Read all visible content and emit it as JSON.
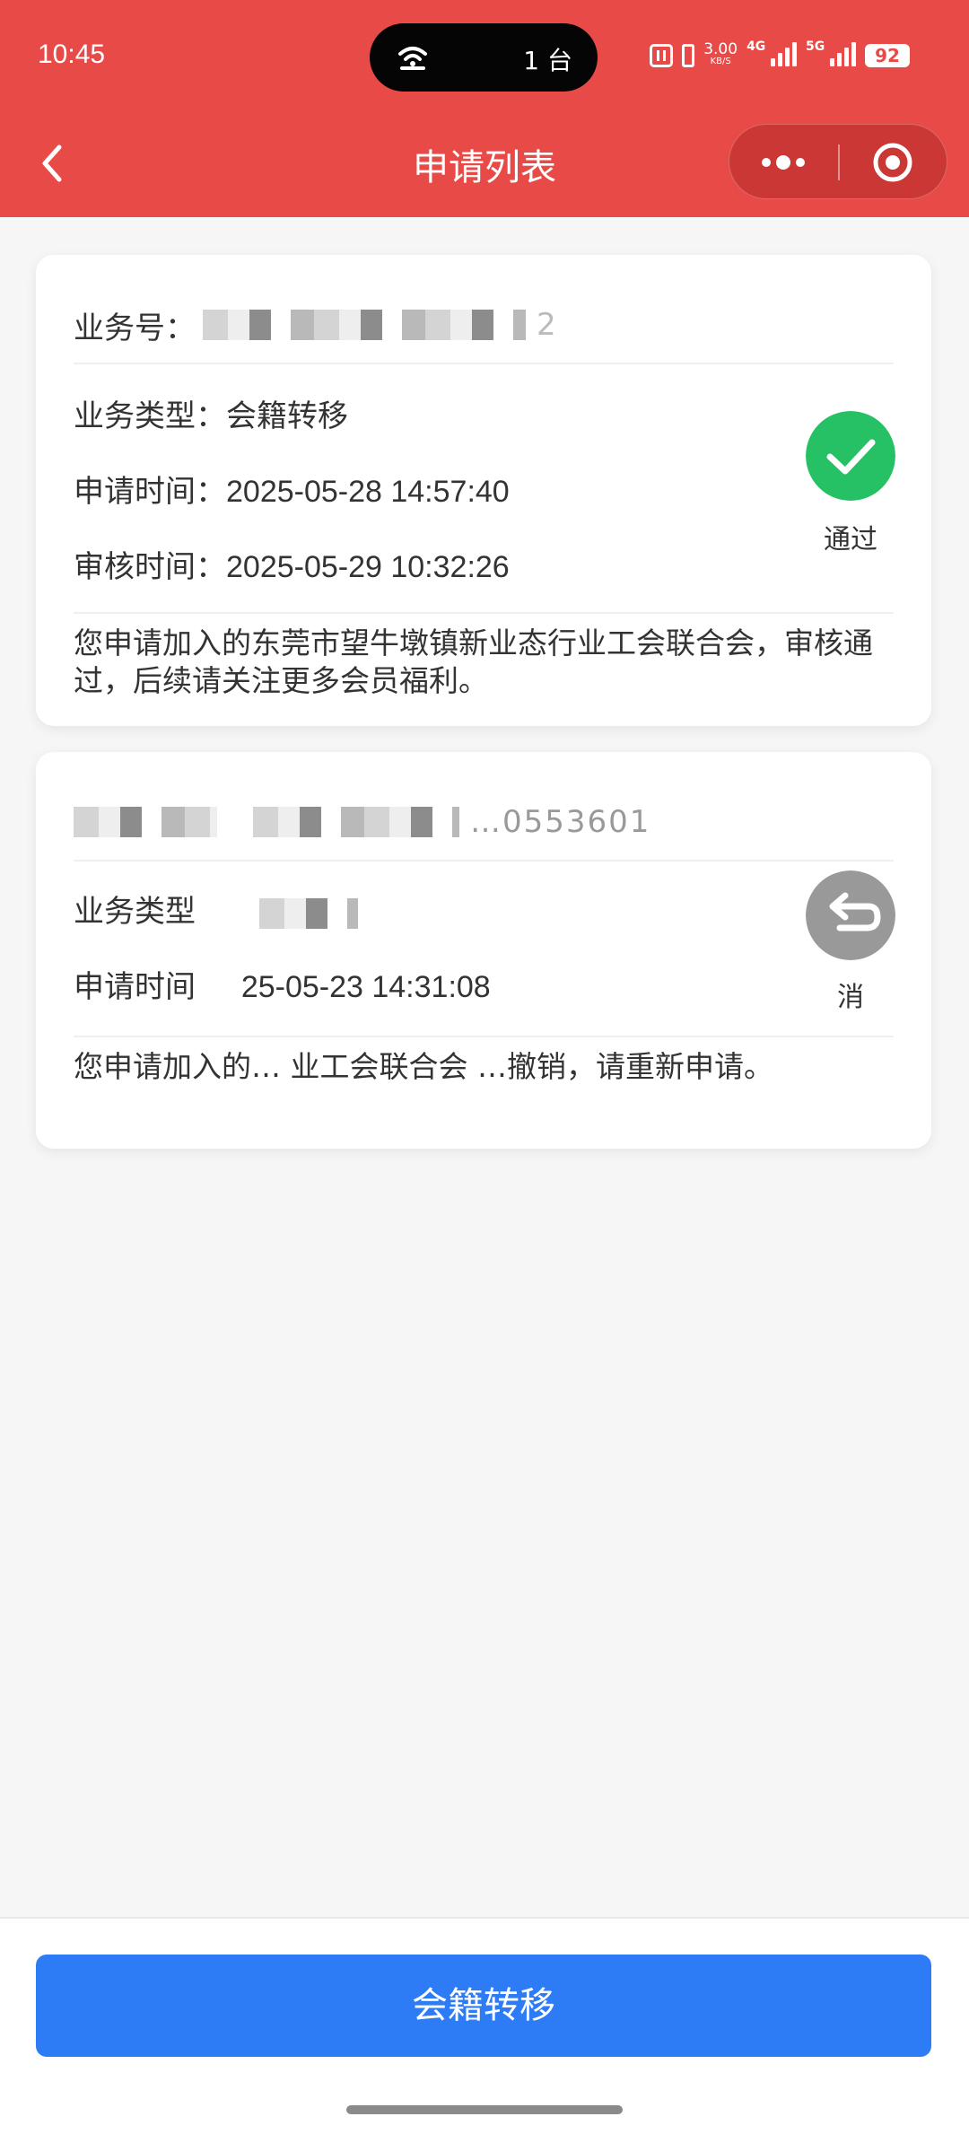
{
  "status_bar": {
    "time": "10:45",
    "island_text": "1 台",
    "speed_value": "3.00",
    "speed_unit": "KB/S",
    "net_4g": "4G",
    "net_5g": "5G",
    "battery": "92"
  },
  "header": {
    "title": "申请列表",
    "back_icon": "chevron-left-icon",
    "more_icon": "more-dots-icon",
    "close_icon": "target-circle-icon"
  },
  "applications": [
    {
      "biz_no_label": "业务号：",
      "biz_no_value": "2",
      "type_label": "业务类型：",
      "type_value": "会籍转移",
      "apply_time_label": "申请时间：",
      "apply_time_value": "2025-05-28 14:57:40",
      "review_time_label": "审核时间：",
      "review_time_value": "2025-05-29 10:32:26",
      "status_label": "通过",
      "status_icon": "check-circle-icon",
      "status_color": "#27c165",
      "note": "您申请加入的东莞市望牛墩镇新业态行业工会联合会，审核通过，后续请关注更多会员福利。"
    },
    {
      "biz_no_value": "…0553601",
      "type_label": "业务类型",
      "apply_time_label": "申请时间",
      "apply_time_value": "25-05-23 14:31:08",
      "status_label": "消",
      "status_icon": "undo-circle-icon",
      "status_color": "#999999",
      "note": "您申请加入的… 业工会联合会 …撤销，请重新申请。"
    }
  ],
  "footer": {
    "button_label": "会籍转移"
  }
}
